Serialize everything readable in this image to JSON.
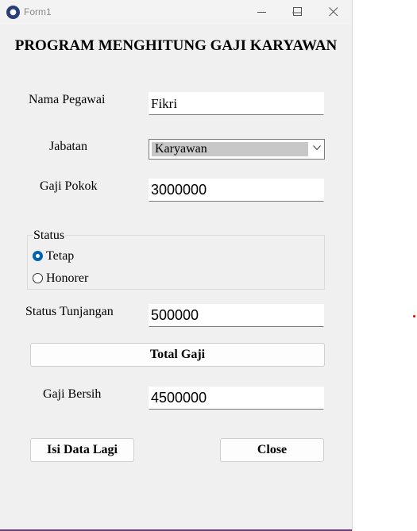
{
  "window": {
    "title": "Form1"
  },
  "heading": "PROGRAM MENGHITUNG GAJI KARYAWAN",
  "nama_pegawai": {
    "label": "Nama Pegawai",
    "value": "Fikri"
  },
  "jabatan": {
    "label": "Jabatan",
    "selected": "Karyawan"
  },
  "gaji_pokok": {
    "label": "Gaji Pokok",
    "value": "3000000"
  },
  "status": {
    "legend": "Status",
    "options": [
      {
        "label": "Tetap",
        "checked": true
      },
      {
        "label": "Honorer",
        "checked": false
      }
    ]
  },
  "status_tunjangan": {
    "label": "Status Tunjangan",
    "value": "500000"
  },
  "total_button": "Total Gaji",
  "gaji_bersih": {
    "label": "Gaji Bersih",
    "value": "4500000"
  },
  "buttons": {
    "isi_data_lagi": "Isi Data Lagi",
    "close": "Close"
  },
  "colors": {
    "accent": "#0063b1",
    "window_bg": "#f0f0f0",
    "title_text": "#8a8a8a"
  }
}
